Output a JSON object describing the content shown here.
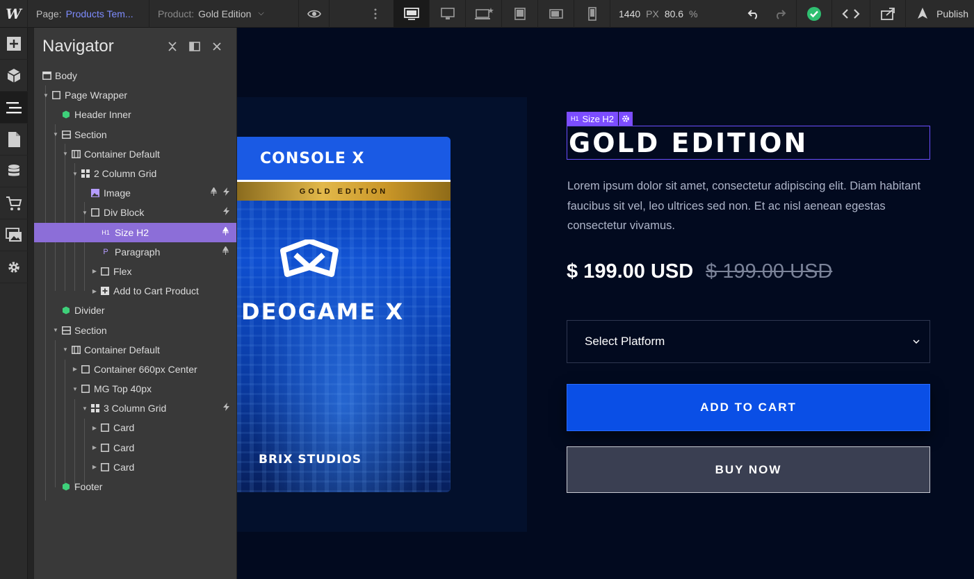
{
  "topbar": {
    "page_label": "Page:",
    "page_value": "Products Tem...",
    "product_label": "Product:",
    "product_value": "Gold Edition",
    "width_value": "1440",
    "width_unit": "PX",
    "zoom_value": "80.6",
    "zoom_unit": "%",
    "publish_label": "Publish"
  },
  "navigator": {
    "title": "Navigator",
    "items": [
      {
        "label": "Body"
      },
      {
        "label": "Page Wrapper"
      },
      {
        "label": "Header Inner"
      },
      {
        "label": "Section"
      },
      {
        "label": "Container Default"
      },
      {
        "label": "2 Column Grid"
      },
      {
        "label": "Image"
      },
      {
        "label": "Div Block"
      },
      {
        "label": "Size H2",
        "badge": "H1"
      },
      {
        "label": "Paragraph",
        "badge": "P"
      },
      {
        "label": "Flex"
      },
      {
        "label": "Add to Cart Product"
      },
      {
        "label": "Divider"
      },
      {
        "label": "Section"
      },
      {
        "label": "Container Default"
      },
      {
        "label": "Container 660px Center"
      },
      {
        "label": "MG Top 40px"
      },
      {
        "label": "3 Column Grid"
      },
      {
        "label": "Card"
      },
      {
        "label": "Card"
      },
      {
        "label": "Card"
      },
      {
        "label": "Footer"
      }
    ]
  },
  "canvas": {
    "element_tag_badge": "H1",
    "element_tag_label": "Size H2",
    "box_art": {
      "top_band": "CONSOLE X",
      "gold_band": "GOLD EDITION",
      "game_title": "DEOGAME X",
      "studio": "BRIX STUDIOS"
    },
    "product_title": "GOLD EDITION",
    "description": "Lorem ipsum dolor sit amet, consectetur adipiscing elit. Diam habitant faucibus sit vel, leo ultrices sed non. Et ac nisl aenean egestas consectetur vivamus.",
    "price_now": "$ 199.00 USD",
    "price_old": "$ 199.00 USD",
    "select_label": "Select Platform",
    "add_to_cart": "ADD TO CART",
    "buy_now": "BUY NOW"
  },
  "colors": {
    "accent_purple": "#8c6ed8",
    "selection_outline": "#6b4fff",
    "cart_blue": "#0a4fe6",
    "canvas_bg": "#020a1f",
    "status_green": "#2fbf71"
  }
}
